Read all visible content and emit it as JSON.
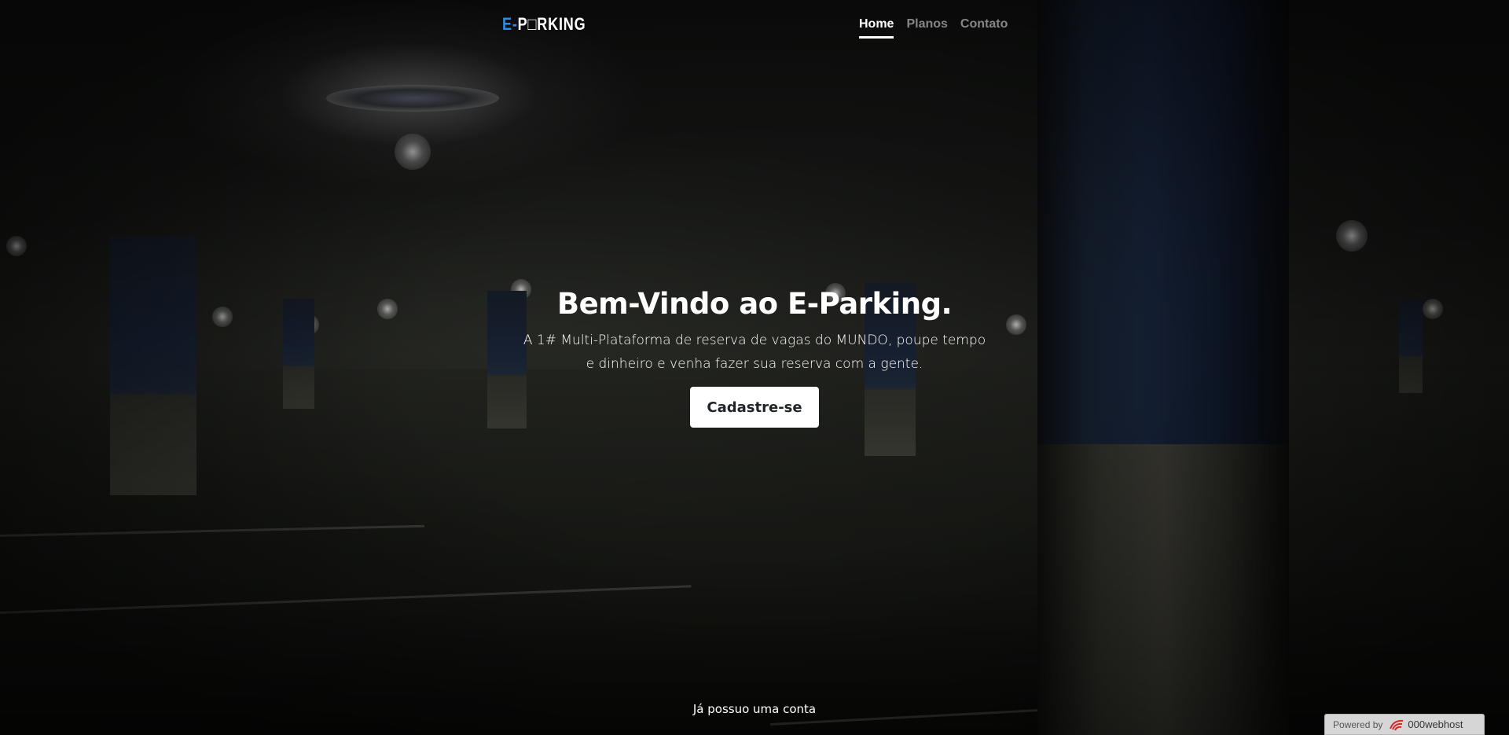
{
  "logo": {
    "prefix": "E-",
    "rest": "P□RKING"
  },
  "nav": {
    "items": [
      {
        "label": "Home",
        "active": true
      },
      {
        "label": "Planos",
        "active": false
      },
      {
        "label": "Contato",
        "active": false
      }
    ]
  },
  "hero": {
    "title": "Bem-Vindo ao E-Parking.",
    "lead": "A 1# Multi-Plataforma de reserva de vagas do MUNDO, poupe tempo e dinheiro e venha fazer sua reserva com a gente.",
    "cta_label": "Cadastre-se"
  },
  "footer": {
    "login_link": "Já possuo uma conta"
  },
  "badge": {
    "powered_label": "Powered by",
    "brand": "000webhost"
  },
  "colors": {
    "accent": "#2f8ce0",
    "text": "#ffffff",
    "button_bg": "#ffffff",
    "button_text": "#212529"
  }
}
